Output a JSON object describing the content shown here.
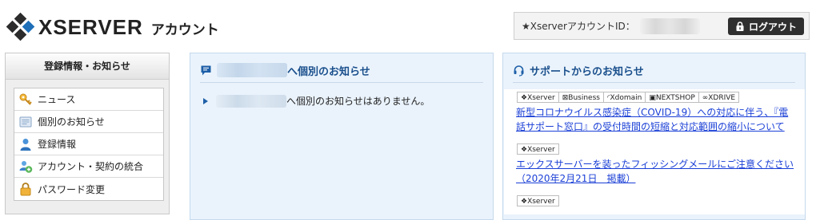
{
  "header": {
    "logo_word": "XSERVER",
    "logo_sub": "アカウント",
    "account_label": "★XserverアカウントID：",
    "logout_label": "ログアウト"
  },
  "sidebar": {
    "title": "登録情報・お知らせ",
    "items": [
      {
        "label": "ニュース",
        "icon": "key-icon"
      },
      {
        "label": "個別のお知らせ",
        "icon": "note-icon"
      },
      {
        "label": "登録情報",
        "icon": "user-icon"
      },
      {
        "label": "アカウント・契約の統合",
        "icon": "merge-icon"
      },
      {
        "label": "パスワード変更",
        "icon": "lock-icon"
      }
    ]
  },
  "personal_notice": {
    "title_suffix": "へ個別のお知らせ",
    "empty_message_suffix": "へ個別のお知らせはありません。"
  },
  "support_notice": {
    "title": "サポートからのお知らせ",
    "tags_all": [
      "❖Xserver",
      "⊠Business",
      "◜Xdomain",
      "▣NEXTSHOP",
      "∞XDRIVE"
    ],
    "news": [
      {
        "tag": "❖Xserver",
        "text": "新型コロナウイルス感染症（COVID-19）への対応に伴う、『電話サポート窓口』の受付時間の短縮と対応範囲の縮小について"
      },
      {
        "tag": "❖Xserver",
        "text": "エックスサーバーを装ったフィッシングメールにご注意ください（2020年2月21日　掲載）"
      }
    ]
  },
  "colors": {
    "accent_blue": "#1e6fb8",
    "panel_bg": "#eaf3fc",
    "heading_blue": "#1a4f8c",
    "link_blue": "#1a3fd6"
  }
}
